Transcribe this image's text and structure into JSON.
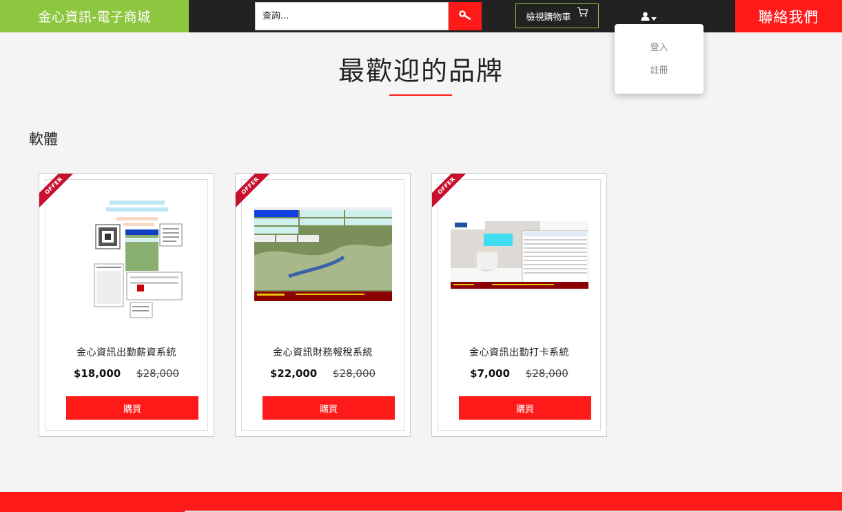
{
  "header": {
    "brand": "金心資訊-電子商城",
    "search_placeholder": "查詢...",
    "cart_label": "檢視購物車",
    "contact_label": "聯絡我們"
  },
  "user_menu": {
    "items": [
      {
        "label": "登入"
      },
      {
        "label": "註冊"
      }
    ]
  },
  "section": {
    "title": "最歡迎的品牌",
    "category": "軟體"
  },
  "products": [
    {
      "ribbon": "OFFER",
      "name": "金心資訊出勤薪資系統",
      "price": "$18,000",
      "old_price": "$28,000",
      "buy_label": "購買"
    },
    {
      "ribbon": "OFFER",
      "name": "金心資訊財務報稅系統",
      "price": "$22,000",
      "old_price": "$28,000",
      "buy_label": "購買"
    },
    {
      "ribbon": "OFFER",
      "name": "金心資訊出勤打卡系統",
      "price": "$7,000",
      "old_price": "$28,000",
      "buy_label": "購買"
    }
  ],
  "colors": {
    "brand_green": "#8dc63f",
    "accent_red": "#ff1a1a",
    "topbar_dark": "#222222",
    "ribbon_red": "#c8102e"
  },
  "icons": [
    "search-icon",
    "cart-icon",
    "user-icon",
    "caret-down-icon"
  ]
}
